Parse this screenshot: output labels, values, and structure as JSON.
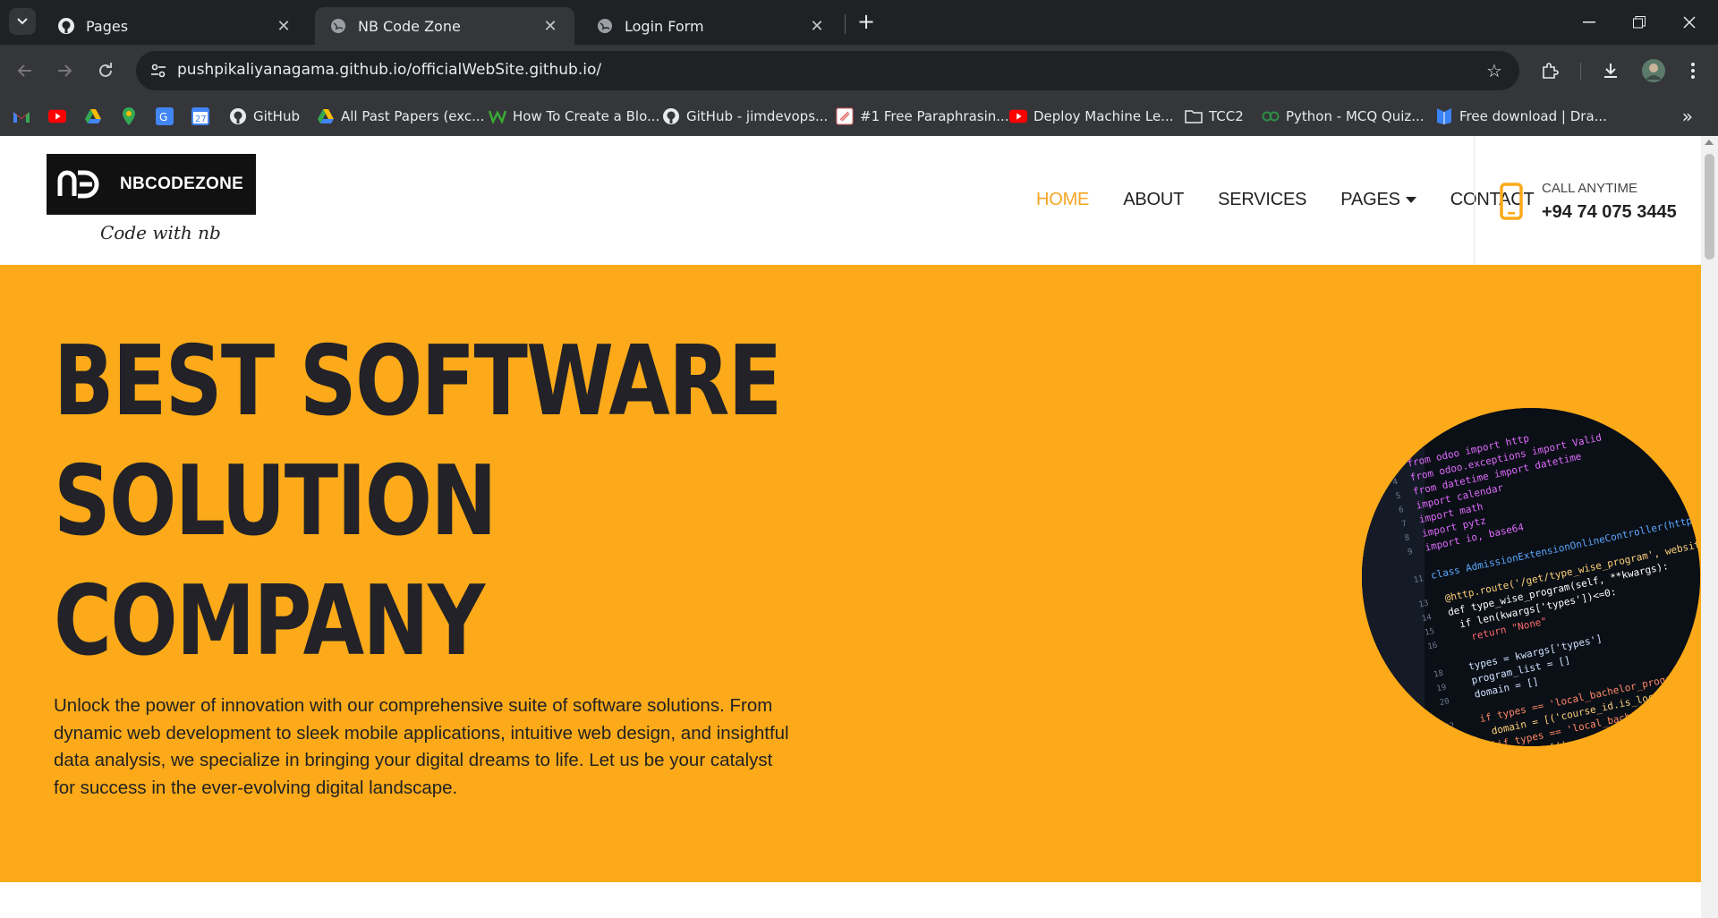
{
  "browser": {
    "tabs": [
      {
        "title": "Pages",
        "icon": "github-icon",
        "active": false
      },
      {
        "title": "NB Code Zone",
        "icon": "globe-icon",
        "active": true
      },
      {
        "title": "Login Form",
        "icon": "globe-icon",
        "active": false
      }
    ],
    "url_host": "pushpikaliyanagama.github.io",
    "url_path": "/officialWebSite.github.io/",
    "bookmarks": [
      {
        "label": "",
        "icon": "gmail-icon"
      },
      {
        "label": "",
        "icon": "youtube-icon"
      },
      {
        "label": "",
        "icon": "drive-icon"
      },
      {
        "label": "",
        "icon": "maps-icon"
      },
      {
        "label": "",
        "icon": "translate-icon"
      },
      {
        "label": "",
        "icon": "calendar-icon"
      },
      {
        "label": "GitHub",
        "icon": "github-icon"
      },
      {
        "label": "All Past Papers (exc...",
        "icon": "drive-icon"
      },
      {
        "label": "How To Create a Blo...",
        "icon": "w-icon"
      },
      {
        "label": "GitHub - jimdevops...",
        "icon": "github-icon"
      },
      {
        "label": "#1 Free Paraphrasin...",
        "icon": "quill-icon"
      },
      {
        "label": "Deploy Machine Le...",
        "icon": "youtube-icon"
      },
      {
        "label": "TCC2",
        "icon": "folder-icon"
      },
      {
        "label": "Python - MCQ Quiz...",
        "icon": "gfg-icon"
      },
      {
        "label": "Free download | Dra...",
        "icon": "drawio-icon"
      }
    ],
    "calendar_day": "27"
  },
  "site": {
    "logo_text": "NBCODEZONE",
    "logo_mark": "nb",
    "tagline": "Code with nb",
    "nav": {
      "home": "HOME",
      "about": "ABOUT",
      "services": "SERVICES",
      "pages": "PAGES",
      "contact": "CONTACT"
    },
    "call_label": "CALL ANYTIME",
    "call_number": "+94 74 075 3445",
    "accent_color": "#fcaa19",
    "active_nav_color": "#f5a623"
  },
  "hero": {
    "title_lines": [
      "BEST SOFTWARE",
      "SOLUTION",
      "COMPANY"
    ],
    "description": "Unlock the power of innovation with our comprehensive suite of software solutions. From dynamic web development to sleek mobile applications, intuitive web design, and insightful data analysis, we specialize in bringing your digital dreams to life. Let us be your catalyst for success in the ever-evolving digital landscape."
  }
}
